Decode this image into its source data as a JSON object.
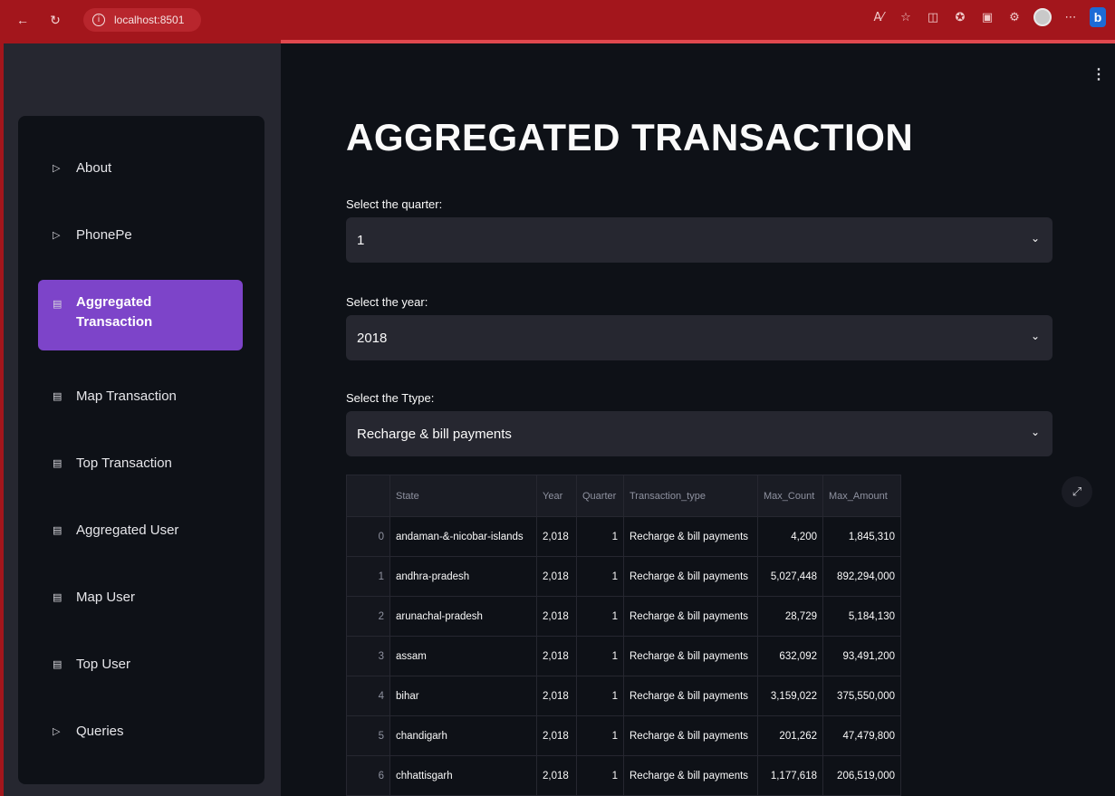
{
  "browser": {
    "url": "localhost:8501",
    "back_icon": "back-arrow-icon",
    "reload_icon": "reload-icon",
    "menu_more": "⋯"
  },
  "sidebar": {
    "items": [
      {
        "icon": "▷",
        "label": "About"
      },
      {
        "icon": "▷",
        "label": "PhonePe"
      },
      {
        "icon": "▤",
        "label": "Aggregated Transaction"
      },
      {
        "icon": "▤",
        "label": "Map Transaction"
      },
      {
        "icon": "▤",
        "label": "Top Transaction"
      },
      {
        "icon": "▤",
        "label": "Aggregated User"
      },
      {
        "icon": "▤",
        "label": "Map User"
      },
      {
        "icon": "▤",
        "label": "Top User"
      },
      {
        "icon": "▷",
        "label": "Queries"
      }
    ],
    "active_index": 2
  },
  "main": {
    "title": "AGGREGATED TRANSACTION",
    "quarter": {
      "label": "Select the quarter:",
      "value": "1"
    },
    "year": {
      "label": "Select the year:",
      "value": "2018"
    },
    "type": {
      "label": "Select the Ttype:",
      "value": "Recharge & bill payments"
    }
  },
  "table": {
    "columns": [
      "",
      "State",
      "Year",
      "Quarter",
      "Transaction_type",
      "Max_Count",
      "Max_Amount"
    ],
    "rows": [
      [
        "0",
        "andaman-&-nicobar-islands",
        "2,018",
        "1",
        "Recharge & bill payments",
        "4,200",
        "1,845,310"
      ],
      [
        "1",
        "andhra-pradesh",
        "2,018",
        "1",
        "Recharge & bill payments",
        "5,027,448",
        "892,294,000"
      ],
      [
        "2",
        "arunachal-pradesh",
        "2,018",
        "1",
        "Recharge & bill payments",
        "28,729",
        "5,184,130"
      ],
      [
        "3",
        "assam",
        "2,018",
        "1",
        "Recharge & bill payments",
        "632,092",
        "93,491,200"
      ],
      [
        "4",
        "bihar",
        "2,018",
        "1",
        "Recharge & bill payments",
        "3,159,022",
        "375,550,000"
      ],
      [
        "5",
        "chandigarh",
        "2,018",
        "1",
        "Recharge & bill payments",
        "201,262",
        "47,479,800"
      ],
      [
        "6",
        "chhattisgarh",
        "2,018",
        "1",
        "Recharge & bill payments",
        "1,177,618",
        "206,519,000"
      ]
    ]
  },
  "colors": {
    "browser_bar": "#a3161c",
    "accent": "#e0484e",
    "active_menu": "#7d44c9",
    "background": "#0e1117",
    "panel": "#262730"
  }
}
